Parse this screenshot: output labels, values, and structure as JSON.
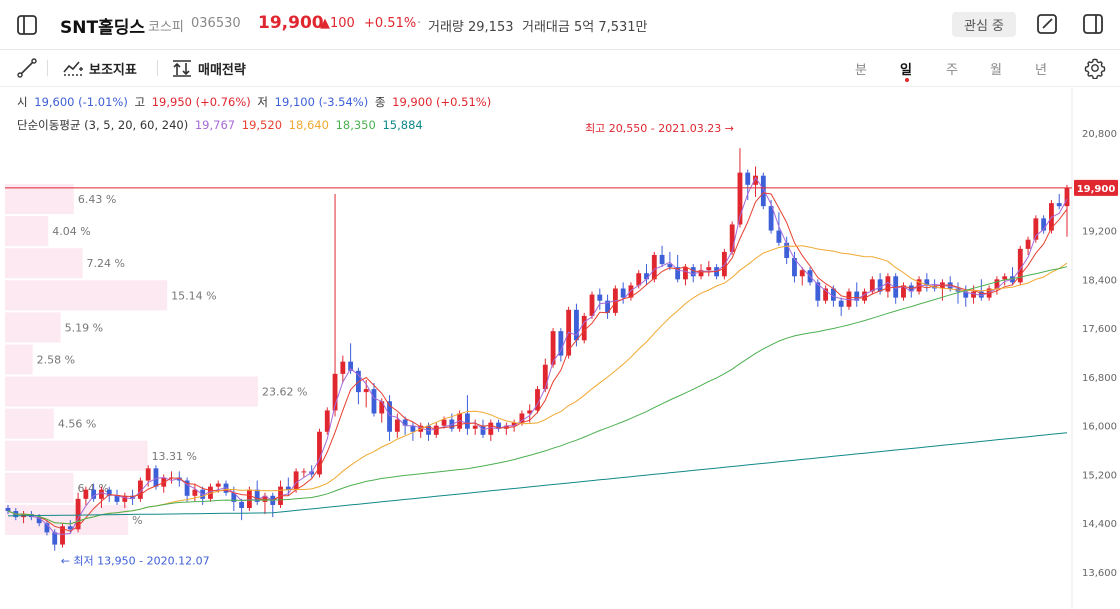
{
  "header": {
    "stock_name": "SNT홀딩스",
    "market": "코스피",
    "code": "036530",
    "price": "19,900",
    "change": "▲100",
    "change_pct": "+0.51%",
    "sep": "·",
    "volume": "거래량 29,153",
    "amount": "거래대금 5억 7,531만",
    "watch_label": "관심 중"
  },
  "toolbar": {
    "indicator_label": "보조지표",
    "strategy_label": "매매전략",
    "periods": [
      "분",
      "일",
      "주",
      "월",
      "년"
    ],
    "active_period": "일"
  },
  "icons": {
    "sidebar": "sidebar-toggle-icon",
    "edit": "edit-icon",
    "panel": "panel-icon",
    "draw": "draw-line-icon",
    "indicator": "indicator-icon",
    "strategy": "strategy-icon",
    "settings": "gear-icon"
  },
  "ohlc": {
    "open_label": "시",
    "open_value": "19,600 (-1.01%)",
    "high_label": "고",
    "high_value": "19,950 (+0.76%)",
    "low_label": "저",
    "low_value": "19,100 (-3.54%)",
    "close_label": "종",
    "close_value": "19,900 (+0.51%)"
  },
  "ma_legend": {
    "label": "단순이동평균 (3, 5, 20, 60, 240)",
    "values": [
      "19,767",
      "19,520",
      "18,640",
      "18,350",
      "15,884"
    ]
  },
  "colors": {
    "up": "#e0262f",
    "down": "#3d5fd8",
    "ma3": "#a66ad8",
    "ma5": "#e8412f",
    "ma20": "#f0a830",
    "ma60": "#4cb050",
    "ma240": "#11888a",
    "volume_profile": "#fde9f1"
  },
  "chart_data": {
    "type": "candlestick",
    "y_ticks": [
      "20,800",
      "19,200",
      "18,400",
      "17,600",
      "16,800",
      "16,000",
      "15,200",
      "14,400",
      "13,600"
    ],
    "ylim": [
      13300,
      21200
    ],
    "current_price_label": "19,900",
    "current_price": 19900,
    "annotation_high": "최고 20,550 - 2021.03.23 →",
    "annotation_low": "← 최저 13,950 - 2020.12.07",
    "volume_profile": [
      {
        "label": "6.43 %",
        "pct": 6.43
      },
      {
        "label": "4.04 %",
        "pct": 4.04
      },
      {
        "label": "7.24 %",
        "pct": 7.24
      },
      {
        "label": "15.14 %",
        "pct": 15.14
      },
      {
        "label": "5.19 %",
        "pct": 5.19
      },
      {
        "label": "2.58 %",
        "pct": 2.58
      },
      {
        "label": "23.62 %",
        "pct": 23.62
      },
      {
        "label": "4.56 %",
        "pct": 4.56
      },
      {
        "label": "13.31 %",
        "pct": 13.31
      },
      {
        "label": "6.4 %",
        "pct": 6.4
      },
      {
        "label": "%",
        "pct": 11.5
      }
    ],
    "candles": [
      [
        14650,
        14700,
        14550,
        14600
      ],
      [
        14600,
        14650,
        14450,
        14500
      ],
      [
        14500,
        14600,
        14400,
        14550
      ],
      [
        14550,
        14600,
        14450,
        14500
      ],
      [
        14500,
        14550,
        14350,
        14400
      ],
      [
        14400,
        14450,
        14200,
        14250
      ],
      [
        14250,
        14300,
        13950,
        14050
      ],
      [
        14050,
        14400,
        14000,
        14350
      ],
      [
        14350,
        14450,
        14250,
        14300
      ],
      [
        14300,
        14900,
        14250,
        14800
      ],
      [
        14800,
        15000,
        14700,
        14950
      ],
      [
        14950,
        15050,
        14750,
        14800
      ],
      [
        14800,
        15000,
        14650,
        14950
      ],
      [
        14950,
        15000,
        14750,
        14850
      ],
      [
        14850,
        14950,
        14700,
        14750
      ],
      [
        14750,
        14900,
        14650,
        14850
      ],
      [
        14850,
        14950,
        14700,
        14800
      ],
      [
        14800,
        15150,
        14750,
        15100
      ],
      [
        15100,
        15350,
        15000,
        15300
      ],
      [
        15300,
        15350,
        14950,
        15000
      ],
      [
        15000,
        15200,
        14900,
        15150
      ],
      [
        15150,
        15250,
        15050,
        15150
      ],
      [
        15150,
        15250,
        15000,
        15100
      ],
      [
        15100,
        15150,
        14750,
        14850
      ],
      [
        14850,
        15050,
        14750,
        14950
      ],
      [
        14950,
        15000,
        14700,
        14800
      ],
      [
        14800,
        15050,
        14750,
        15000
      ],
      [
        15000,
        15100,
        14900,
        15050
      ],
      [
        15050,
        15100,
        14850,
        14900
      ],
      [
        14900,
        15000,
        14600,
        14750
      ],
      [
        14750,
        14800,
        14450,
        14650
      ],
      [
        14650,
        15000,
        14600,
        14950
      ],
      [
        14950,
        15100,
        14700,
        14750
      ],
      [
        14750,
        14900,
        14550,
        14850
      ],
      [
        14850,
        14900,
        14500,
        14700
      ],
      [
        14700,
        15100,
        14650,
        15000
      ],
      [
        15000,
        15150,
        14850,
        14950
      ],
      [
        14950,
        15300,
        14900,
        15250
      ],
      [
        15250,
        15300,
        15150,
        15250
      ],
      [
        15250,
        15350,
        15150,
        15200
      ],
      [
        15200,
        15950,
        15150,
        15900
      ],
      [
        15900,
        16300,
        15850,
        16250
      ],
      [
        16250,
        19800,
        16150,
        16850
      ],
      [
        16850,
        17150,
        16700,
        17050
      ],
      [
        17050,
        17350,
        16850,
        16900
      ],
      [
        16900,
        16950,
        16350,
        16550
      ],
      [
        16550,
        16750,
        16300,
        16600
      ],
      [
        16600,
        16700,
        16150,
        16200
      ],
      [
        16200,
        16450,
        16050,
        16400
      ],
      [
        16400,
        16500,
        15750,
        15900
      ],
      [
        15900,
        16200,
        15800,
        16100
      ],
      [
        16100,
        16150,
        15850,
        16000
      ],
      [
        16000,
        16050,
        15750,
        15900
      ],
      [
        15900,
        16050,
        15800,
        16000
      ],
      [
        16000,
        16050,
        15750,
        15850
      ],
      [
        15850,
        16050,
        15800,
        16000
      ],
      [
        16000,
        16150,
        15950,
        16100
      ],
      [
        16100,
        16200,
        15900,
        15950
      ],
      [
        15950,
        16250,
        15900,
        16200
      ],
      [
        16200,
        16500,
        15850,
        15950
      ],
      [
        15950,
        16100,
        15850,
        16000
      ],
      [
        16000,
        16100,
        15800,
        15850
      ],
      [
        15850,
        16100,
        15750,
        16050
      ],
      [
        16050,
        16100,
        15900,
        15950
      ],
      [
        15950,
        16050,
        15850,
        16000
      ],
      [
        16000,
        16100,
        15900,
        16050
      ],
      [
        16050,
        16250,
        16000,
        16200
      ],
      [
        16200,
        16350,
        16050,
        16250
      ],
      [
        16250,
        16650,
        16200,
        16600
      ],
      [
        16600,
        17100,
        16550,
        17000
      ],
      [
        17000,
        17600,
        16950,
        17550
      ],
      [
        17550,
        17600,
        17050,
        17150
      ],
      [
        17150,
        17950,
        17100,
        17900
      ],
      [
        17900,
        18000,
        17300,
        17400
      ],
      [
        17400,
        17850,
        17350,
        17800
      ],
      [
        17800,
        18200,
        17750,
        18150
      ],
      [
        18150,
        18250,
        17900,
        18050
      ],
      [
        18050,
        18150,
        17750,
        17850
      ],
      [
        17850,
        18300,
        17800,
        18250
      ],
      [
        18250,
        18350,
        18000,
        18100
      ],
      [
        18100,
        18350,
        18050,
        18300
      ],
      [
        18300,
        18550,
        18250,
        18500
      ],
      [
        18500,
        18650,
        18300,
        18400
      ],
      [
        18400,
        18850,
        18350,
        18800
      ],
      [
        18800,
        18950,
        18600,
        18650
      ],
      [
        18650,
        18850,
        18550,
        18600
      ],
      [
        18600,
        18800,
        18350,
        18400
      ],
      [
        18400,
        18650,
        18300,
        18600
      ],
      [
        18600,
        18650,
        18350,
        18450
      ],
      [
        18450,
        18650,
        18400,
        18550
      ],
      [
        18550,
        18700,
        18450,
        18600
      ],
      [
        18600,
        18650,
        18400,
        18450
      ],
      [
        18450,
        18900,
        18400,
        18850
      ],
      [
        18850,
        19350,
        18800,
        19300
      ],
      [
        19300,
        20550,
        19250,
        20150
      ],
      [
        20150,
        20200,
        19700,
        19950
      ],
      [
        19950,
        20250,
        19750,
        20100
      ],
      [
        20100,
        20150,
        19550,
        19600
      ],
      [
        19600,
        19700,
        19150,
        19200
      ],
      [
        19200,
        19500,
        18950,
        19000
      ],
      [
        19000,
        19100,
        18650,
        18750
      ],
      [
        18750,
        18850,
        18350,
        18450
      ],
      [
        18450,
        18600,
        18300,
        18550
      ],
      [
        18550,
        18600,
        18300,
        18350
      ],
      [
        18350,
        18400,
        17950,
        18050
      ],
      [
        18050,
        18300,
        18000,
        18250
      ],
      [
        18250,
        18300,
        17950,
        18050
      ],
      [
        18050,
        18100,
        17800,
        17950
      ],
      [
        17950,
        18250,
        17900,
        18200
      ],
      [
        18200,
        18350,
        17950,
        18050
      ],
      [
        18050,
        18250,
        18000,
        18200
      ],
      [
        18200,
        18450,
        18150,
        18400
      ],
      [
        18400,
        18500,
        18150,
        18200
      ],
      [
        18200,
        18500,
        18100,
        18450
      ],
      [
        18450,
        18500,
        18000,
        18100
      ],
      [
        18100,
        18350,
        18050,
        18300
      ],
      [
        18300,
        18350,
        18100,
        18200
      ],
      [
        18200,
        18450,
        18150,
        18400
      ],
      [
        18400,
        18500,
        18200,
        18300
      ],
      [
        18300,
        18400,
        18200,
        18250
      ],
      [
        18250,
        18400,
        18050,
        18350
      ],
      [
        18350,
        18450,
        18200,
        18250
      ],
      [
        18250,
        18350,
        18000,
        18200
      ],
      [
        18200,
        18300,
        17950,
        18100
      ],
      [
        18100,
        18300,
        18000,
        18200
      ],
      [
        18200,
        18400,
        18050,
        18100
      ],
      [
        18100,
        18300,
        18050,
        18250
      ],
      [
        18250,
        18450,
        18150,
        18400
      ],
      [
        18400,
        18500,
        18300,
        18450
      ],
      [
        18450,
        18600,
        18300,
        18350
      ],
      [
        18350,
        18950,
        18300,
        18900
      ],
      [
        18900,
        19100,
        18800,
        19050
      ],
      [
        19050,
        19450,
        19000,
        19400
      ],
      [
        19400,
        19450,
        19150,
        19200
      ],
      [
        19200,
        19700,
        19150,
        19650
      ],
      [
        19650,
        19800,
        19550,
        19600
      ],
      [
        19600,
        19950,
        19100,
        19900
      ]
    ]
  }
}
